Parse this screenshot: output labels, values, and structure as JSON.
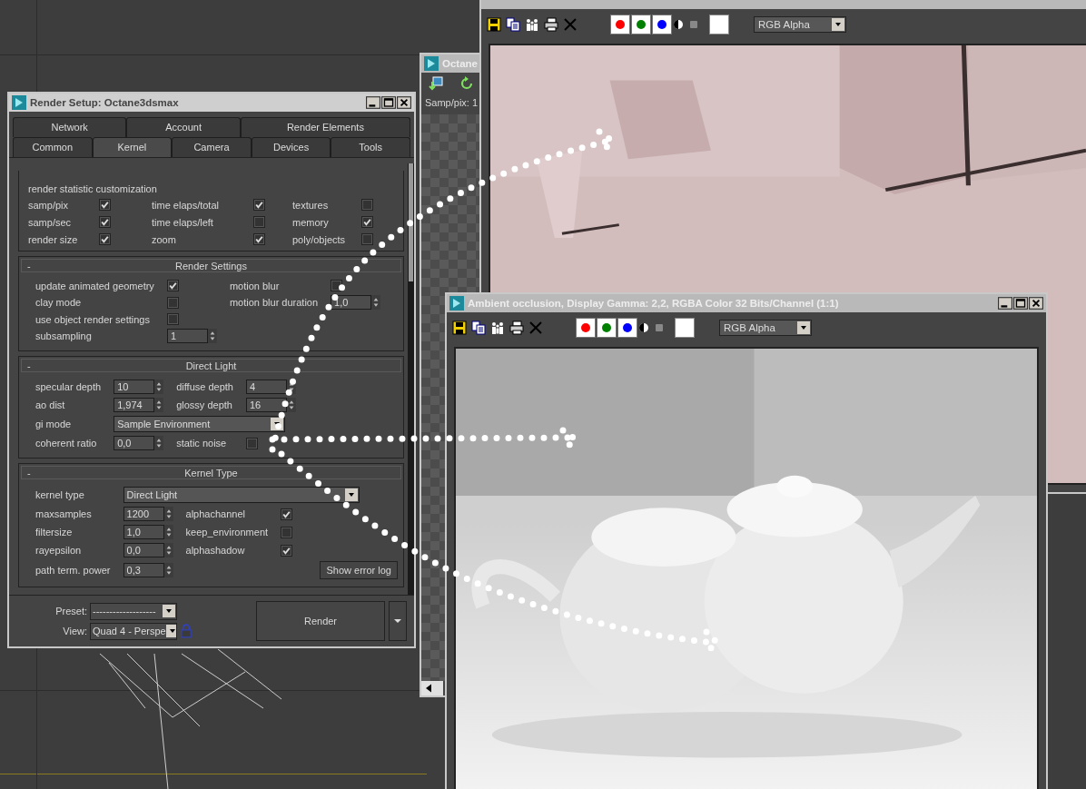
{
  "octane_window": {
    "title": "Octane",
    "stat": "Samp/pix: 1"
  },
  "beauty_window": {
    "toolbar": {
      "channels": [
        {
          "color": "#ff0000"
        },
        {
          "color": "#008000"
        },
        {
          "color": "#0000ff"
        }
      ],
      "display": "RGB Alpha"
    }
  },
  "ao_window": {
    "title": "Ambient occlusion, Display Gamma: 2,2, RGBA Color 32 Bits/Channel (1:1)",
    "toolbar": {
      "channels": [
        {
          "color": "#ff0000"
        },
        {
          "color": "#008000"
        },
        {
          "color": "#0000ff"
        }
      ],
      "display": "RGB Alpha"
    }
  },
  "render_setup": {
    "title": "Render Setup: Octane3dsmax",
    "tab_rows": [
      [
        {
          "label": "Network",
          "selected": false
        },
        {
          "label": "Account",
          "selected": false
        },
        {
          "label": "Render Elements",
          "selected": false
        }
      ],
      [
        {
          "label": "Common",
          "selected": false
        },
        {
          "label": "Kernel",
          "selected": true
        },
        {
          "label": "Camera",
          "selected": false
        },
        {
          "label": "Devices",
          "selected": false
        },
        {
          "label": "Tools",
          "selected": false
        }
      ]
    ],
    "statistics": {
      "heading": "render statistic customization",
      "items": [
        {
          "label": "samp/pix",
          "checked": true
        },
        {
          "label": "time elaps/total",
          "checked": true
        },
        {
          "label": "textures",
          "checked": false
        },
        {
          "label": "samp/sec",
          "checked": true
        },
        {
          "label": "time elaps/left",
          "checked": false
        },
        {
          "label": "memory",
          "checked": true
        },
        {
          "label": "render size",
          "checked": true
        },
        {
          "label": "zoom",
          "checked": true
        },
        {
          "label": "poly/objects",
          "checked": false
        }
      ]
    },
    "rollouts": [
      {
        "toggle": "-",
        "title": "Render Settings",
        "rows": [
          [
            {
              "kind": "check",
              "label": "update animated geometry",
              "checked": true
            },
            {
              "kind": "check",
              "label": "motion blur",
              "checked": false
            }
          ],
          [
            {
              "kind": "check",
              "label": "clay mode",
              "checked": false
            },
            {
              "kind": "spinner",
              "label": "motion blur duration",
              "value": "1,0"
            }
          ],
          [
            {
              "kind": "check",
              "label": "use object render settings",
              "checked": false
            }
          ],
          [
            {
              "kind": "spinner",
              "label": "subsampling",
              "value": "1"
            }
          ]
        ]
      },
      {
        "toggle": "-",
        "title": "Direct Light",
        "rows": [
          [
            {
              "kind": "spinner",
              "label": "specular depth",
              "value": "10"
            },
            {
              "kind": "spinner",
              "label": "diffuse depth",
              "value": "4"
            }
          ],
          [
            {
              "kind": "spinner",
              "label": "ao dist",
              "value": "1,974"
            },
            {
              "kind": "spinner",
              "label": "glossy depth",
              "value": "16"
            }
          ],
          [
            {
              "kind": "dropdown",
              "label": "gi mode",
              "value": "Sample Environment"
            }
          ],
          [
            {
              "kind": "spinner",
              "label": "coherent ratio",
              "value": "0,0"
            },
            {
              "kind": "check",
              "label": "static noise",
              "checked": false
            }
          ]
        ]
      },
      {
        "toggle": "-",
        "title": "Kernel Type",
        "rows": [
          [
            {
              "kind": "dropdown",
              "label": "kernel type",
              "value": "Direct Light"
            }
          ],
          [
            {
              "kind": "spinner",
              "label": "maxsamples",
              "value": "1200"
            },
            {
              "kind": "check",
              "label": "alphachannel",
              "checked": true
            }
          ],
          [
            {
              "kind": "spinner",
              "label": "filtersize",
              "value": "1,0"
            },
            {
              "kind": "check",
              "label": "keep_environment",
              "checked": false
            }
          ],
          [
            {
              "kind": "spinner",
              "label": "rayepsilon",
              "value": "0,0"
            },
            {
              "kind": "check",
              "label": "alphashadow",
              "checked": true
            }
          ],
          [
            {
              "kind": "spinner",
              "label": "path term. power",
              "value": "0,3"
            },
            {
              "kind": "button",
              "label": "Show error log"
            }
          ]
        ]
      }
    ],
    "preset": {
      "label": "Preset:",
      "value": "-------------------"
    },
    "view": {
      "label": "View:",
      "value": "Quad 4 - Perspe"
    },
    "render_button": "Render"
  }
}
